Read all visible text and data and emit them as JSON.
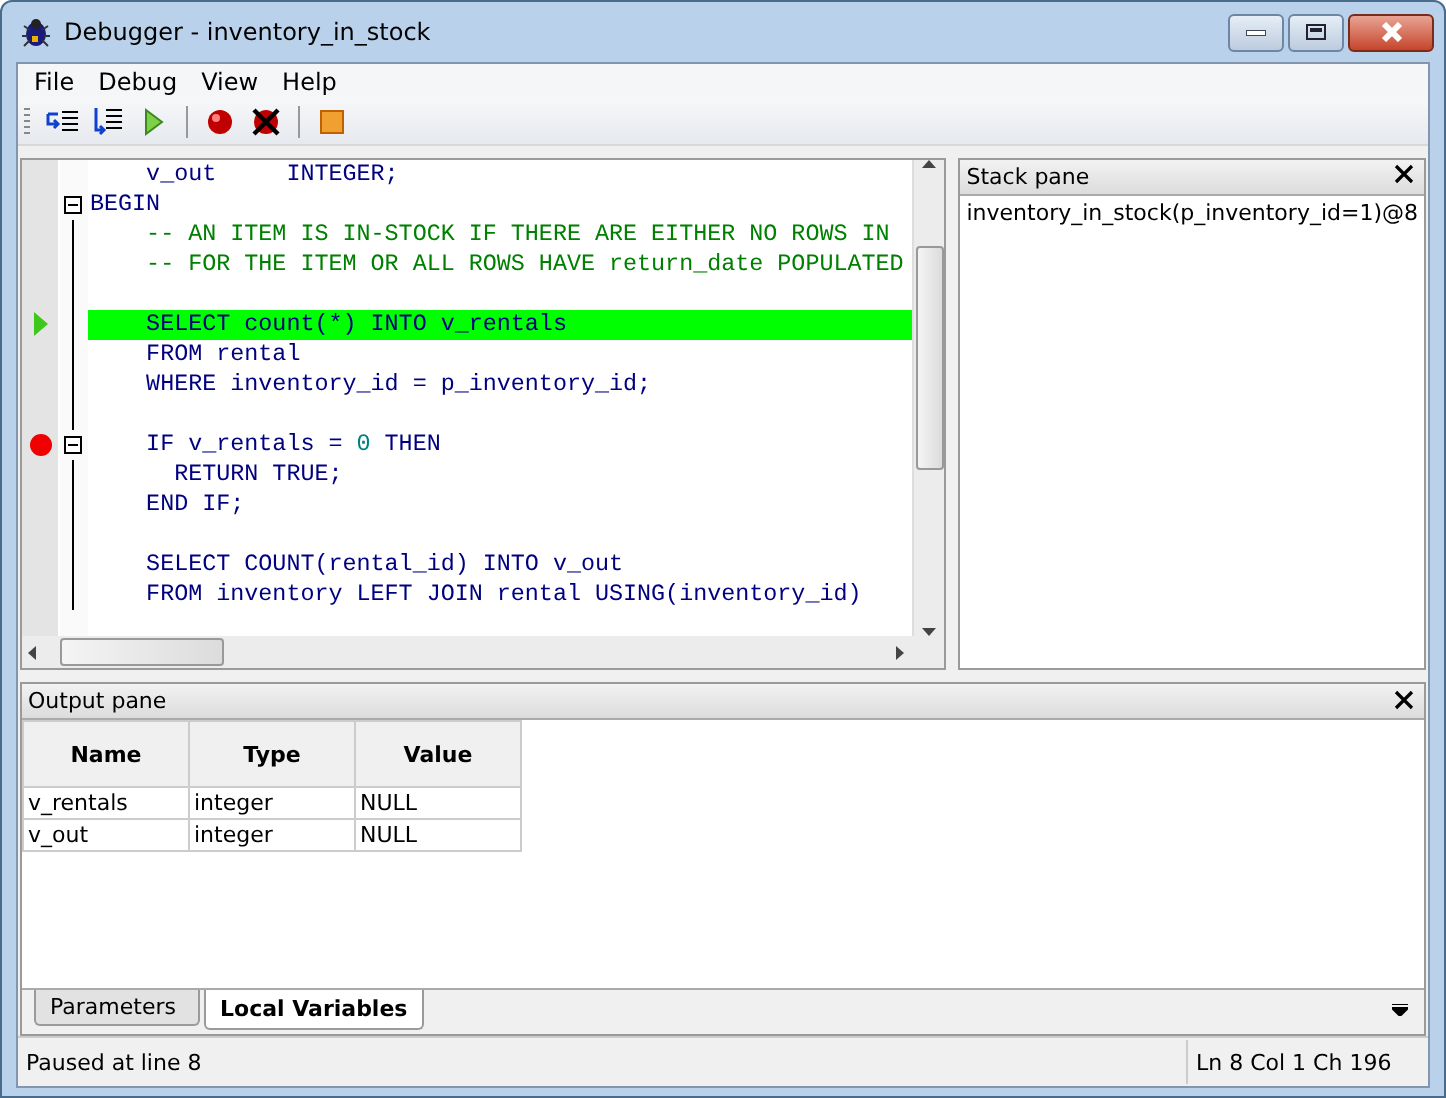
{
  "window": {
    "title": "Debugger - inventory_in_stock"
  },
  "menu": [
    {
      "label": "File"
    },
    {
      "label": "Debug"
    },
    {
      "label": "View"
    },
    {
      "label": "Help"
    }
  ],
  "code": {
    "lines": [
      {
        "current": false,
        "breakpoint": false,
        "collapsible": false,
        "segments": [
          {
            "kind": "code",
            "text": "    v_out     INTEGER;"
          }
        ]
      },
      {
        "current": false,
        "breakpoint": false,
        "collapsible": true,
        "segments": [
          {
            "kind": "code",
            "text": "BEGIN"
          }
        ]
      },
      {
        "current": false,
        "breakpoint": false,
        "collapsible": false,
        "segments": [
          {
            "kind": "comment",
            "text": "    -- AN ITEM IS IN-STOCK IF THERE ARE EITHER NO ROWS IN"
          }
        ]
      },
      {
        "current": false,
        "breakpoint": false,
        "collapsible": false,
        "segments": [
          {
            "kind": "comment",
            "text": "    -- FOR THE ITEM OR ALL ROWS HAVE return_date POPULATED"
          }
        ]
      },
      {
        "current": false,
        "breakpoint": false,
        "collapsible": false
      },
      {
        "current": true,
        "breakpoint": false,
        "collapsible": false,
        "segments": [
          {
            "kind": "code",
            "text": "    SELECT count(*) INTO v_rentals"
          }
        ]
      },
      {
        "current": false,
        "breakpoint": false,
        "collapsible": false,
        "segments": [
          {
            "kind": "code",
            "text": "    FROM rental"
          }
        ]
      },
      {
        "current": false,
        "breakpoint": false,
        "collapsible": false,
        "segments": [
          {
            "kind": "code",
            "text": "    WHERE inventory_id = p_inventory_id;"
          }
        ]
      },
      {
        "current": false,
        "breakpoint": false,
        "collapsible": false
      },
      {
        "current": false,
        "breakpoint": true,
        "collapsible": true,
        "segments": [
          {
            "kind": "code",
            "text": "    IF v_rentals = "
          },
          {
            "kind": "number",
            "text": "0"
          },
          {
            "kind": "code",
            "text": " THEN"
          }
        ]
      },
      {
        "current": false,
        "breakpoint": false,
        "collapsible": false,
        "segments": [
          {
            "kind": "code",
            "text": "      RETURN TRUE;"
          }
        ]
      },
      {
        "current": false,
        "breakpoint": false,
        "collapsible": false,
        "segments": [
          {
            "kind": "code",
            "text": "    END IF;"
          }
        ]
      },
      {
        "current": false,
        "breakpoint": false,
        "collapsible": false
      },
      {
        "current": false,
        "breakpoint": false,
        "collapsible": false,
        "segments": [
          {
            "kind": "code",
            "text": "    SELECT COUNT(rental_id) INTO v_out"
          }
        ]
      },
      {
        "current": false,
        "breakpoint": false,
        "collapsible": false,
        "segments": [
          {
            "kind": "code",
            "text": "    FROM inventory LEFT JOIN rental USING(inventory_id)"
          }
        ]
      }
    ]
  },
  "stack_pane": {
    "title": "Stack pane",
    "items": [
      "inventory_in_stock(p_inventory_id=1)@8"
    ]
  },
  "output_pane": {
    "title": "Output pane",
    "columns": [
      "Name",
      "Type",
      "Value"
    ],
    "rows": [
      [
        "v_rentals",
        "integer",
        "NULL"
      ],
      [
        "v_out",
        "integer",
        "NULL"
      ]
    ],
    "tabs": [
      {
        "label": "Parameters",
        "selected": false
      },
      {
        "label": "Local Variables",
        "selected": true
      }
    ]
  },
  "status_bar": {
    "message": "Paused at line 8",
    "position": "Ln 8 Col 1 Ch 196"
  }
}
